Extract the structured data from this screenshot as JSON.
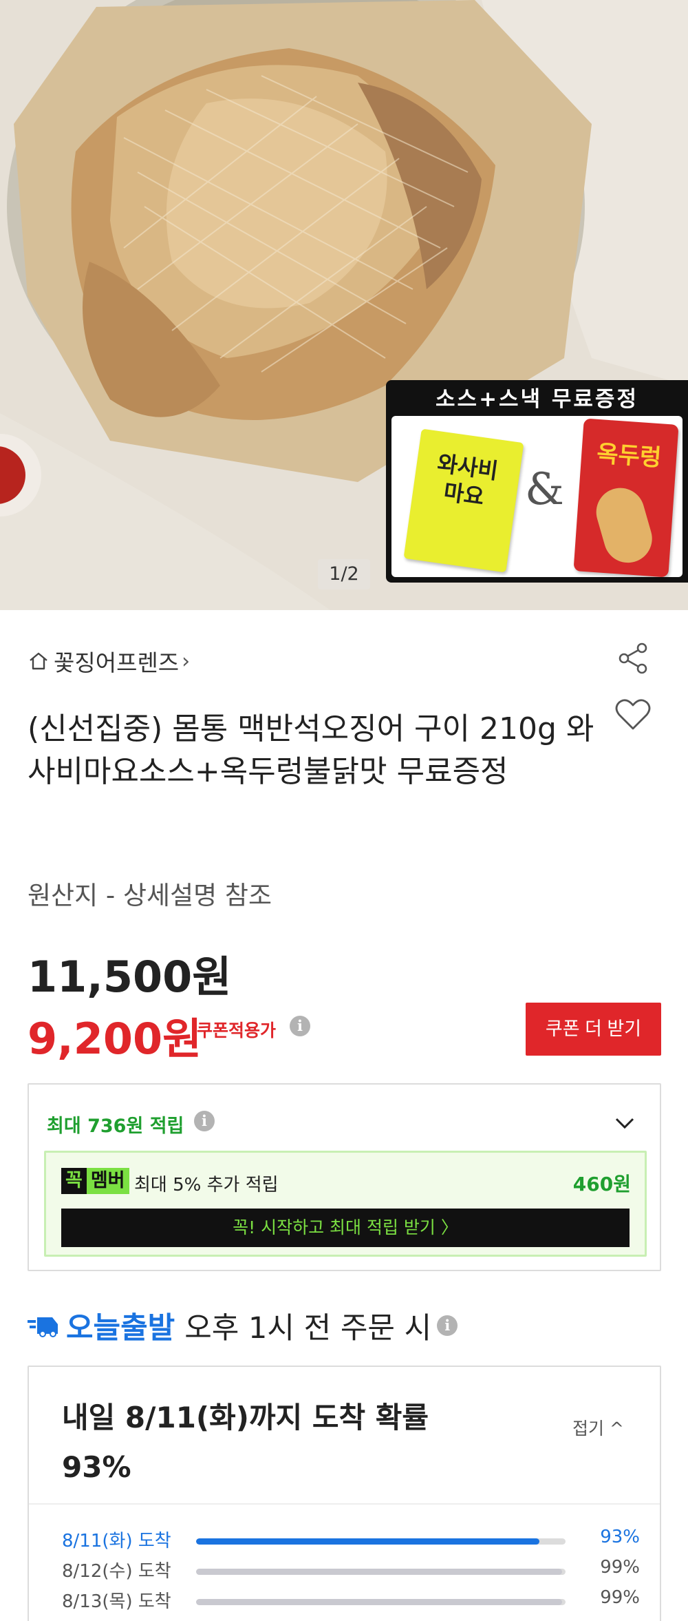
{
  "gallery": {
    "page_indicator": "1/2",
    "promo_title": "소스+스낵 무료증정",
    "sauce_label": "와사비\n마요",
    "ampersand": "&",
    "snack_label": "옥두렁"
  },
  "product": {
    "store_name": "꽃징어프렌즈",
    "title": "(신선집중) 몸통 맥반석오징어 구이 210g 와사비마요소스+옥두렁불닭맛 무료증정",
    "origin": "원산지 - 상세설명 참조",
    "original_price": "11,500원",
    "sale_price": "9,200원",
    "coupon_price_label": "쿠폰적용가",
    "coupon_button": "쿠폰 더 받기"
  },
  "reward": {
    "prefix": "최대 ",
    "amount": "736원",
    "suffix": " 적립",
    "member_badge_a": "꼭",
    "member_badge_b": "멤버",
    "member_text": "최대 5% 추가 적립",
    "member_amount": "460원",
    "member_cta": "꼭! 시작하고 최대 적립 받기  〉"
  },
  "delivery": {
    "brand": "오늘출발",
    "condition": "오후 1시 전 주문 시",
    "title": "내일 8/11(화)까지 도착 확률 93%",
    "fold_label": "접기 ^",
    "rows": [
      {
        "date": "8/11(화) 도착",
        "percent": "93%",
        "fill": 0.93
      },
      {
        "date": "8/12(수) 도착",
        "percent": "99%",
        "fill": 0.99
      },
      {
        "date": "8/13(목) 도착",
        "percent": "99%",
        "fill": 0.99
      }
    ]
  },
  "colors": {
    "sale_red": "#e0262a",
    "reward_green": "#1f9f2f",
    "delivery_blue": "#1a73e0"
  }
}
